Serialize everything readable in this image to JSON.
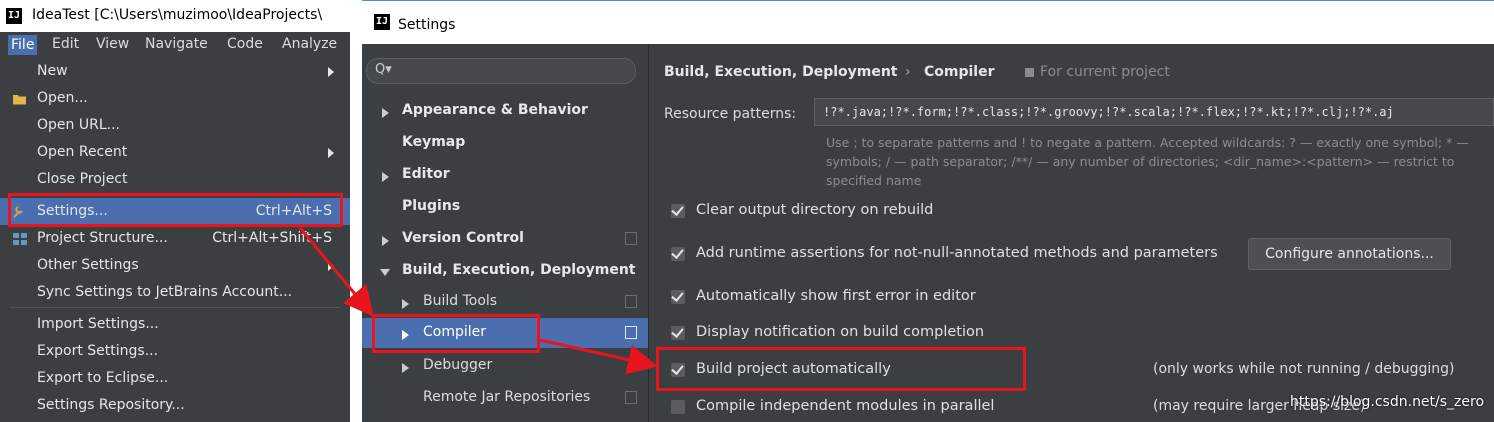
{
  "ide": {
    "title": "IdeaTest [C:\\Users\\muzimoo\\IdeaProjects\\",
    "menubar": [
      "File",
      "Edit",
      "View",
      "Navigate",
      "Code",
      "Analyze"
    ],
    "file_menu": [
      {
        "label": "New",
        "submenu": true
      },
      {
        "label": "Open...",
        "icon": "folder-icon"
      },
      {
        "label": "Open URL..."
      },
      {
        "label": "Open Recent",
        "submenu": true
      },
      {
        "label": "Close Project"
      },
      {
        "label": "Settings...",
        "shortcut": "Ctrl+Alt+S",
        "icon": "wrench-icon",
        "selected": true
      },
      {
        "label": "Project Structure...",
        "shortcut": "Ctrl+Alt+Shift+S",
        "icon": "project-structure-icon"
      },
      {
        "label": "Other Settings",
        "submenu": true
      },
      {
        "label": "Sync Settings to JetBrains Account..."
      },
      {
        "label": "Import Settings..."
      },
      {
        "label": "Export Settings..."
      },
      {
        "label": "Export to Eclipse..."
      },
      {
        "label": "Settings Repository..."
      }
    ]
  },
  "settings": {
    "title": "Settings",
    "search_icon": "Q▾",
    "tree": [
      {
        "label": "Appearance & Behavior",
        "bold": true,
        "expander": "right"
      },
      {
        "label": "Keymap",
        "bold": true
      },
      {
        "label": "Editor",
        "bold": true,
        "expander": "right"
      },
      {
        "label": "Plugins",
        "bold": true
      },
      {
        "label": "Version Control",
        "bold": true,
        "expander": "right",
        "copy_icon": true
      },
      {
        "label": "Build, Execution, Deployment",
        "bold": true,
        "expander": "down"
      },
      {
        "label": "Build Tools",
        "expander": "right",
        "copy_icon": true
      },
      {
        "label": "Compiler",
        "expander": "right",
        "copy_icon": true,
        "selected": true
      },
      {
        "label": "Debugger",
        "expander": "right"
      },
      {
        "label": "Remote Jar Repositories",
        "copy_icon": true
      }
    ],
    "breadcrumb": [
      "Build, Execution, Deployment",
      "Compiler"
    ],
    "breadcrumb_sep": "›",
    "for_current_project": "For current project",
    "resource_patterns_label": "Resource patterns:",
    "resource_patterns_value": "!?*.java;!?*.form;!?*.class;!?*.groovy;!?*.scala;!?*.flex;!?*.kt;!?*.clj;!?*.aj",
    "help_lines": [
      "Use ; to separate patterns and ! to negate a pattern. Accepted wildcards: ? — exactly one symbol; * —",
      "symbols; / — path separator; /**/ — any number of directories; <dir_name>:<pattern> — restrict to",
      "specified name"
    ],
    "options": [
      {
        "label": "Clear output directory on rebuild",
        "checked": true
      },
      {
        "label": "Add runtime assertions for not-null-annotated methods and parameters",
        "checked": true
      },
      {
        "label": "Automatically show first error in editor",
        "checked": true
      },
      {
        "label": "Display notification on build completion",
        "checked": true
      },
      {
        "label": "Build project automatically",
        "checked": true,
        "note": "(only works while not running / debugging)"
      },
      {
        "label": "Compile independent modules in parallel",
        "checked": false,
        "note": "(may require larger heap size)"
      }
    ],
    "configure_annotations_button": "Configure annotations..."
  },
  "watermark": "https://blog.csdn.net/s_zero",
  "colors": {
    "highlight": "#e8141e",
    "selection": "#4b6eaf",
    "dark_bg": "#3c3f41"
  }
}
